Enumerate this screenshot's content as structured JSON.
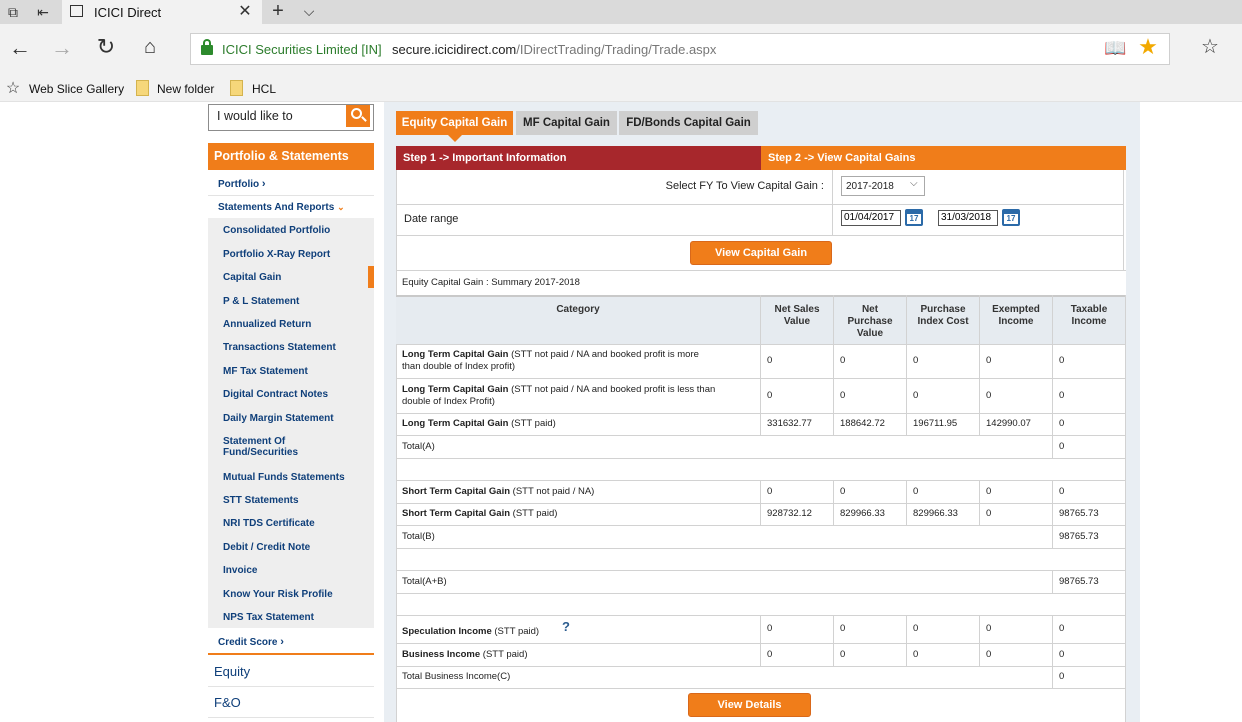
{
  "browser": {
    "tab_title": "ICICI Direct",
    "site_identity": "ICICI Securities Limited [IN]",
    "url_domain": "secure.icicidirect.com",
    "url_path": "/IDirectTrading/Trading/Trade.aspx",
    "favorites": [
      "Web Slice Gallery",
      "New folder",
      "HCL"
    ]
  },
  "sidebar": {
    "search_placeholder": "I would like to",
    "section_title": "Portfolio & Statements",
    "portfolio": "Portfolio",
    "statements_label": "Statements And Reports",
    "items": [
      "Consolidated Portfolio",
      "Portfolio X-Ray Report",
      "Capital Gain",
      "P & L Statement",
      "Annualized Return",
      "Transactions Statement",
      "MF Tax Statement",
      "Digital Contract Notes",
      "Daily Margin Statement",
      "Statement Of",
      "Fund/Securities",
      "Mutual Funds Statements",
      "STT Statements",
      "NRI TDS Certificate",
      "Debit / Credit Note",
      "Invoice",
      "Know Your Risk Profile",
      "NPS Tax Statement"
    ],
    "credit_score": "Credit Score",
    "equity": "Equity",
    "fno": "F&O"
  },
  "tabs": [
    "Equity Capital Gain",
    "MF Capital Gain",
    "FD/Bonds Capital Gain"
  ],
  "steps": {
    "step1": "Step 1 -> Important Information",
    "step2": "Step 2 -> View Capital Gains"
  },
  "form": {
    "fy_label": "Select FY To View Capital Gain :",
    "fy_value": "2017-2018",
    "date_range_label": "Date range",
    "date_from": "01/04/2017",
    "date_to": "31/03/2018",
    "cal_day": "17",
    "view_button": "View Capital Gain"
  },
  "summary_title": "Equity Capital Gain : Summary 2017-2018",
  "table": {
    "headers": {
      "category": "Category",
      "net_sales": [
        "Net Sales",
        "Value"
      ],
      "net_purchase": [
        "Net",
        "Purchase",
        "Value"
      ],
      "purchase_index": [
        "Purchase",
        "Index Cost"
      ],
      "exempted": [
        "Exempted",
        "Income"
      ],
      "taxable": [
        "Taxable",
        "Income"
      ]
    },
    "rows": {
      "ltcg1": {
        "bold": "Long Term Capital Gain",
        "rest1": " (STT not paid / NA and booked profit is more",
        "rest2": "than double of Index profit)",
        "v": [
          "0",
          "0",
          "0",
          "0",
          "0"
        ]
      },
      "ltcg2": {
        "bold": "Long Term Capital Gain",
        "rest1": " (STT not paid / NA and booked profit is less than",
        "rest2": "double of Index Profit)",
        "v": [
          "0",
          "0",
          "0",
          "0",
          "0"
        ]
      },
      "ltcg3": {
        "bold": "Long Term Capital Gain",
        "rest": " (STT paid)",
        "v": [
          "331632.77",
          "188642.72",
          "196711.95",
          "142990.07",
          "0"
        ]
      },
      "total_a": {
        "label": "Total(A)",
        "taxable": "0"
      },
      "stcg1": {
        "bold": "Short Term Capital Gain",
        "rest": " (STT not paid / NA)",
        "v": [
          "0",
          "0",
          "0",
          "0",
          "0"
        ]
      },
      "stcg2": {
        "bold": "Short Term Capital Gain",
        "rest": " (STT paid)",
        "v": [
          "928732.12",
          "829966.33",
          "829966.33",
          "0",
          "98765.73"
        ]
      },
      "total_b": {
        "label": "Total(B)",
        "taxable": "98765.73"
      },
      "total_ab": {
        "label": "Total(A+B)",
        "taxable": "98765.73"
      },
      "spec": {
        "bold": "Speculation Income",
        "rest": " (STT paid)",
        "help": "?",
        "v": [
          "0",
          "0",
          "0",
          "0",
          "0"
        ]
      },
      "biz": {
        "bold": "Business Income",
        "rest": " (STT paid)",
        "v": [
          "0",
          "0",
          "0",
          "0",
          "0"
        ]
      },
      "total_biz": {
        "label": "Total Business Income(C)",
        "taxable": "0"
      }
    }
  },
  "details_button": "View Details"
}
